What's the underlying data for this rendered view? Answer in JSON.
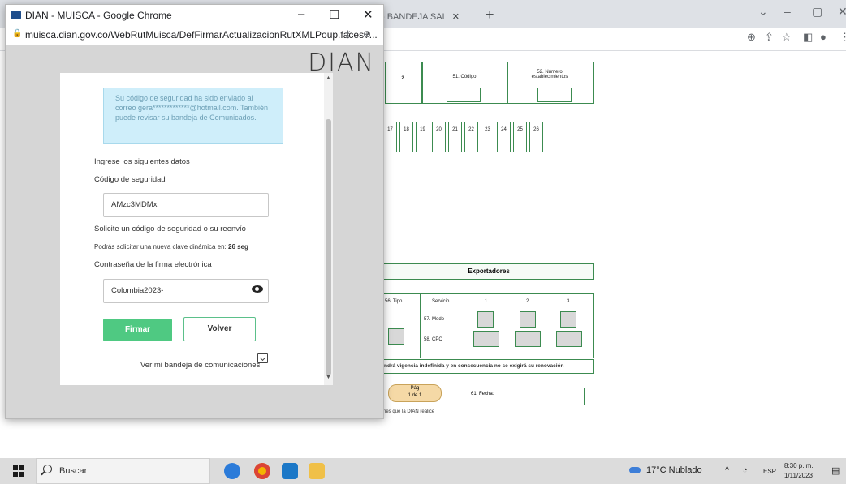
{
  "background_window": {
    "tab_label": "- BANDEJA SAL",
    "form": {
      "labels": {
        "box2": "2",
        "codigo": "51. Código",
        "num_establecimientos": "52. Número establecimientos"
      },
      "number_cells": [
        "17",
        "18",
        "19",
        "20",
        "21",
        "22",
        "23",
        "24",
        "25",
        "26"
      ],
      "exportadores_title": "Exportadores",
      "tipo": "56. Tipo",
      "servicio": "Servicio",
      "col1": "1",
      "col2": "2",
      "col3": "3",
      "modo": "57. Modo",
      "cpc": "58. CPC",
      "vigencia_text": "ndrá vigencia indefinida y en consecuencia no se exigirá su renovación",
      "pag_label": "Pág",
      "pag_value": "1 de 1",
      "fecha": "61. Fecha:",
      "bottom_note": "nes que la DIAN realice"
    }
  },
  "popup": {
    "title": "DIAN - MUISCA - Google Chrome",
    "url": "muisca.dian.gov.co/WebRutMuisca/DefFirmarActualizacionRutXMLPoup.faces?...",
    "logo_text": "DIAN",
    "info_message": "Su código de seguridad ha sido enviado al correo gera*************@hotmail.com. También puede revisar su bandeja de Comunicados.",
    "ingrese_label": "Ingrese los siguientes datos",
    "codigo_label": "Código de seguridad",
    "codigo_value": "AMzc3MDMx",
    "solicite_label": "Solicite un código de seguridad o su reenvío",
    "nueva_clave_label": "Podrás solicitar una nueva clave dinámica en:",
    "nueva_clave_seconds": "26 seg",
    "contrasena_label": "Contraseña de la firma electrónica",
    "contrasena_value": "Colombia2023-",
    "firmar_button": "Firmar",
    "volver_button": "Volver",
    "bandeja_link": "Ver mi bandeja de comunicaciones"
  },
  "taskbar": {
    "search_placeholder": "Buscar",
    "weather": "17°C Nublado",
    "language": "ESP",
    "time": "8:30 p. m.",
    "date": "1/11/2023"
  }
}
